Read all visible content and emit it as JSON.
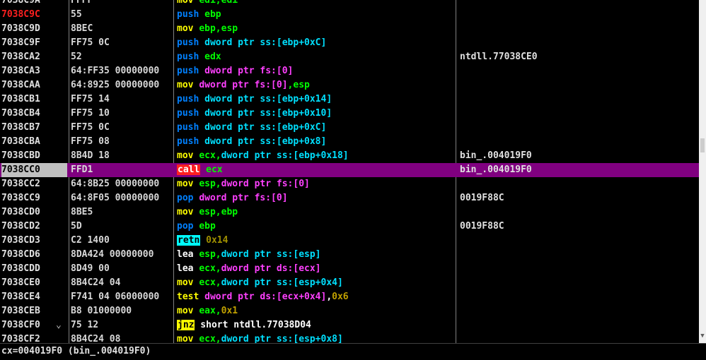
{
  "rows": [
    {
      "addr": "7038C9A",
      "bytes": "FFFF",
      "tokens": [
        {
          "t": "mov ",
          "c": "c-yellow"
        },
        {
          "t": "edi,edi",
          "c": "c-green"
        }
      ],
      "comment": "",
      "addr_color": "#e0e0e0"
    },
    {
      "addr": "7038C9C",
      "bytes": "55",
      "tokens": [
        {
          "t": "push ",
          "c": "c-blue"
        },
        {
          "t": "ebp",
          "c": "c-green"
        }
      ],
      "comment": "",
      "addr_color": "#ff2020"
    },
    {
      "addr": "7038C9D",
      "bytes": "8BEC",
      "tokens": [
        {
          "t": "mov ",
          "c": "c-yellow"
        },
        {
          "t": "ebp,esp",
          "c": "c-green"
        }
      ],
      "comment": ""
    },
    {
      "addr": "7038C9F",
      "bytes": "FF75 0C",
      "tokens": [
        {
          "t": "push ",
          "c": "c-blue"
        },
        {
          "t": "dword ptr ss:[ebp+0xC]",
          "c": "c-cyan"
        }
      ],
      "comment": ""
    },
    {
      "addr": "7038CA2",
      "bytes": "52",
      "tokens": [
        {
          "t": "push ",
          "c": "c-blue"
        },
        {
          "t": "edx",
          "c": "c-green"
        }
      ],
      "comment": "ntdll.77038CE0"
    },
    {
      "addr": "7038CA3",
      "bytes": "64:FF35 00000000",
      "tokens": [
        {
          "t": "push ",
          "c": "c-blue"
        },
        {
          "t": "dword ptr fs:[0]",
          "c": "c-magenta"
        }
      ],
      "comment": ""
    },
    {
      "addr": "7038CAA",
      "bytes": "64:8925 00000000",
      "tokens": [
        {
          "t": "mov ",
          "c": "c-yellow"
        },
        {
          "t": "dword ptr fs:[0]",
          "c": "c-magenta"
        },
        {
          "t": ",esp",
          "c": "c-green"
        }
      ],
      "comment": ""
    },
    {
      "addr": "7038CB1",
      "bytes": "FF75 14",
      "tokens": [
        {
          "t": "push ",
          "c": "c-blue"
        },
        {
          "t": "dword ptr ss:[ebp+0x14]",
          "c": "c-cyan"
        }
      ],
      "comment": ""
    },
    {
      "addr": "7038CB4",
      "bytes": "FF75 10",
      "tokens": [
        {
          "t": "push ",
          "c": "c-blue"
        },
        {
          "t": "dword ptr ss:[ebp+0x10]",
          "c": "c-cyan"
        }
      ],
      "comment": ""
    },
    {
      "addr": "7038CB7",
      "bytes": "FF75 0C",
      "tokens": [
        {
          "t": "push ",
          "c": "c-blue"
        },
        {
          "t": "dword ptr ss:[ebp+0xC]",
          "c": "c-cyan"
        }
      ],
      "comment": ""
    },
    {
      "addr": "7038CBA",
      "bytes": "FF75 08",
      "tokens": [
        {
          "t": "push ",
          "c": "c-blue"
        },
        {
          "t": "dword ptr ss:[ebp+0x8]",
          "c": "c-cyan"
        }
      ],
      "comment": ""
    },
    {
      "addr": "7038CBD",
      "bytes": "8B4D 18",
      "tokens": [
        {
          "t": "mov ",
          "c": "c-yellow"
        },
        {
          "t": "ecx,",
          "c": "c-green"
        },
        {
          "t": "dword ptr ss:[ebp+0x18]",
          "c": "c-cyan"
        }
      ],
      "comment": "bin_.004019F0"
    },
    {
      "addr": "7038CC0",
      "bytes": "FFD1",
      "tokens": [
        {
          "t": "call",
          "c": "badge-call"
        },
        {
          "t": " ecx",
          "c": "c-green"
        }
      ],
      "comment": "bin_.004019F0",
      "selected": true
    },
    {
      "addr": "7038CC2",
      "bytes": "64:8B25 00000000",
      "tokens": [
        {
          "t": "mov ",
          "c": "c-yellow"
        },
        {
          "t": "esp,",
          "c": "c-green"
        },
        {
          "t": "dword ptr fs:[0]",
          "c": "c-magenta"
        }
      ],
      "comment": ""
    },
    {
      "addr": "7038CC9",
      "bytes": "64:8F05 00000000",
      "tokens": [
        {
          "t": "pop ",
          "c": "c-blue"
        },
        {
          "t": "dword ptr fs:[0]",
          "c": "c-magenta"
        }
      ],
      "comment": "0019F88C"
    },
    {
      "addr": "7038CD0",
      "bytes": "8BE5",
      "tokens": [
        {
          "t": "mov ",
          "c": "c-yellow"
        },
        {
          "t": "esp,ebp",
          "c": "c-green"
        }
      ],
      "comment": ""
    },
    {
      "addr": "7038CD2",
      "bytes": "5D",
      "tokens": [
        {
          "t": "pop ",
          "c": "c-blue"
        },
        {
          "t": "ebp",
          "c": "c-green"
        }
      ],
      "comment": "0019F88C"
    },
    {
      "addr": "7038CD3",
      "bytes": "C2 1400",
      "tokens": [
        {
          "t": "retn",
          "c": "badge-ret"
        },
        {
          "t": " 0x14",
          "c": "c-olive"
        }
      ],
      "comment": ""
    },
    {
      "addr": "7038CD6",
      "bytes": "8DA424 00000000",
      "tokens": [
        {
          "t": "lea ",
          "c": "c-white"
        },
        {
          "t": "esp,",
          "c": "c-green"
        },
        {
          "t": "dword ptr ss:[esp]",
          "c": "c-cyan"
        }
      ],
      "comment": ""
    },
    {
      "addr": "7038CDD",
      "bytes": "8D49 00",
      "tokens": [
        {
          "t": "lea ",
          "c": "c-white"
        },
        {
          "t": "ecx,",
          "c": "c-green"
        },
        {
          "t": "dword ptr ds:[ecx]",
          "c": "c-magenta"
        }
      ],
      "comment": ""
    },
    {
      "addr": "7038CE0",
      "bytes": "8B4C24 04",
      "tokens": [
        {
          "t": "mov ",
          "c": "c-yellow"
        },
        {
          "t": "ecx,",
          "c": "c-green"
        },
        {
          "t": "dword ptr ss:[esp+0x4]",
          "c": "c-cyan"
        }
      ],
      "comment": ""
    },
    {
      "addr": "7038CE4",
      "bytes": "F741 04 06000000",
      "tokens": [
        {
          "t": "test ",
          "c": "c-yellow"
        },
        {
          "t": "dword ptr ds:[ecx+0x4]",
          "c": "c-magenta"
        },
        {
          "t": ",",
          "c": "c-white"
        },
        {
          "t": "0x6",
          "c": "c-olive-num"
        }
      ],
      "comment": ""
    },
    {
      "addr": "7038CEB",
      "bytes": "B8 01000000",
      "tokens": [
        {
          "t": "mov ",
          "c": "c-yellow"
        },
        {
          "t": "eax,",
          "c": "c-green"
        },
        {
          "t": "0x1",
          "c": "c-olive-num"
        }
      ],
      "comment": ""
    },
    {
      "addr": "7038CF0",
      "bytes": "75 12",
      "arrow": "⌄",
      "tokens": [
        {
          "t": "jnz",
          "c": "badge-jcc"
        },
        {
          "t": " short ntdll.77038D04",
          "c": "c-white"
        }
      ],
      "comment": ""
    },
    {
      "addr": "7038CF2",
      "bytes": "8B4C24 08",
      "tokens": [
        {
          "t": "mov ",
          "c": "c-yellow"
        },
        {
          "t": "ecx,",
          "c": "c-green"
        },
        {
          "t": "dword ptr ss:[esp+0x8]",
          "c": "c-cyan"
        }
      ],
      "comment": ""
    }
  ],
  "status": {
    "text": "cx=004019F0 (bin_.004019F0)"
  },
  "colors": {
    "selected_row": "#800080",
    "background": "#000000"
  }
}
